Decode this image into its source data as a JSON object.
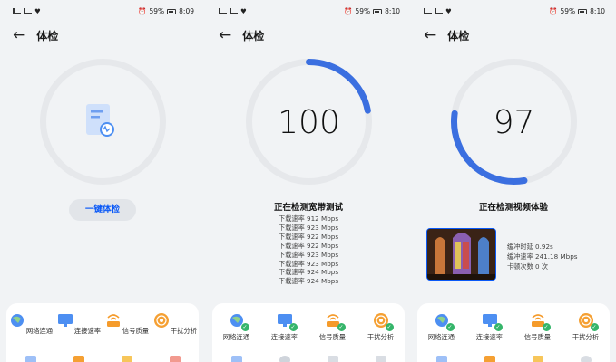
{
  "panels": [
    {
      "status_time": "8:09",
      "battery": "59%",
      "title": "体检",
      "button_label": "一键体检",
      "items": [
        "网络连通",
        "连接速率",
        "信号质量",
        "干扰分析"
      ]
    },
    {
      "status_time": "8:10",
      "battery": "59%",
      "title": "体检",
      "score": "100",
      "progress": 0.22,
      "status_text": "正在检测宽带测试",
      "speed_lines": [
        "下载速率 912 Mbps",
        "下载速率 923 Mbps",
        "下载速率 922 Mbps",
        "下载速率 922 Mbps",
        "下载速率 923 Mbps",
        "下载速率 923 Mbps",
        "下载速率 924 Mbps",
        "下载速率 924 Mbps"
      ],
      "items": [
        "网络连通",
        "连接速率",
        "信号质量",
        "干扰分析"
      ]
    },
    {
      "status_time": "8:10",
      "battery": "59%",
      "title": "体检",
      "score": "97",
      "progress": 0.3,
      "status_text": "正在检测视频体验",
      "video_stats": [
        "缓冲时延 0.92s",
        "缓冲速率 241.18 Mbps",
        "卡顿次数 0 次"
      ],
      "items": [
        "网络连通",
        "连接速率",
        "信号质量",
        "干扰分析"
      ]
    }
  ],
  "colors": {
    "accent": "#0a59f7",
    "ring_track": "#e6e8eb",
    "check": "#35b56a"
  }
}
